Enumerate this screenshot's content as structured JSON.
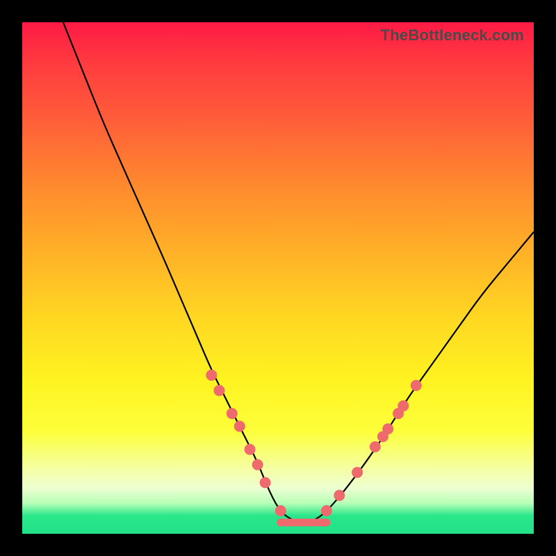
{
  "watermark": "TheBottleneck.com",
  "colors": {
    "frame": "#000000",
    "curve": "#000000",
    "marker": "#ee6a6c"
  },
  "chart_data": {
    "type": "line",
    "title": "",
    "xlabel": "",
    "ylabel": "",
    "xlim": [
      0,
      100
    ],
    "ylim": [
      0,
      100
    ],
    "grid": false,
    "legend": false,
    "series": [
      {
        "name": "bottleneck-curve",
        "x": [
          8,
          12,
          16,
          20,
          24,
          28,
          31,
          34,
          37,
          40,
          43,
          46,
          48,
          50,
          52,
          55,
          58,
          61,
          65,
          70,
          75,
          80,
          85,
          90,
          95,
          100
        ],
        "y": [
          100,
          90,
          80,
          71,
          62,
          53,
          46,
          39,
          32,
          26,
          20,
          14,
          9,
          5,
          3,
          2,
          3,
          6,
          11,
          18,
          26,
          33,
          40,
          47,
          53,
          59
        ]
      }
    ],
    "markers": {
      "name": "highlighted-points",
      "points": [
        {
          "x": 37.0,
          "y": 31.0
        },
        {
          "x": 38.5,
          "y": 28.0
        },
        {
          "x": 41.0,
          "y": 23.5
        },
        {
          "x": 42.5,
          "y": 21.0
        },
        {
          "x": 44.5,
          "y": 16.5
        },
        {
          "x": 46.0,
          "y": 13.5
        },
        {
          "x": 47.5,
          "y": 10.0
        },
        {
          "x": 50.5,
          "y": 4.5
        },
        {
          "x": 59.5,
          "y": 4.5
        },
        {
          "x": 62.0,
          "y": 7.5
        },
        {
          "x": 65.5,
          "y": 12.0
        },
        {
          "x": 69.0,
          "y": 17.0
        },
        {
          "x": 70.5,
          "y": 19.0
        },
        {
          "x": 71.5,
          "y": 20.5
        },
        {
          "x": 73.5,
          "y": 23.5
        },
        {
          "x": 74.5,
          "y": 25.0
        },
        {
          "x": 77.0,
          "y": 29.0
        }
      ]
    },
    "plateau": {
      "name": "optimal-range",
      "x_start": 50.5,
      "x_end": 59.5,
      "y": 2.2
    }
  }
}
